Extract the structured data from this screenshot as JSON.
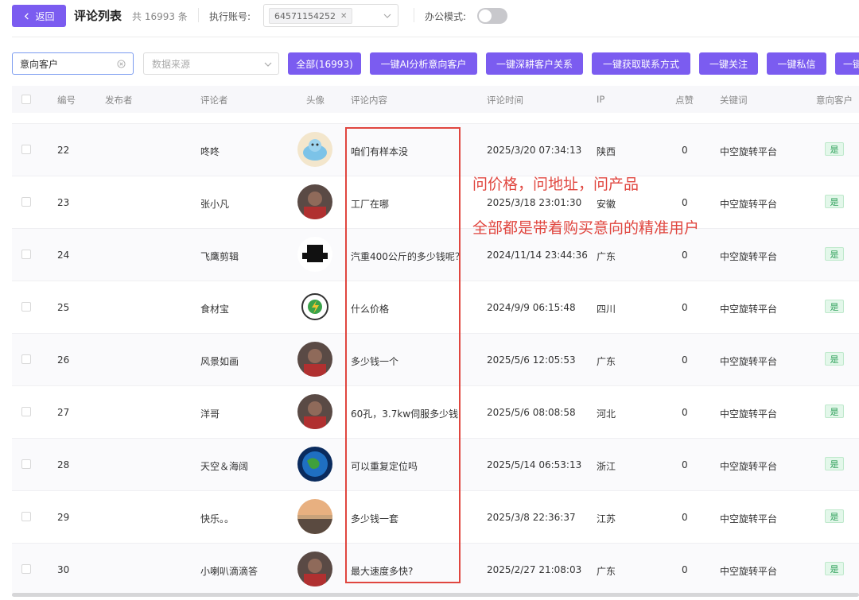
{
  "header": {
    "back_label": "返回",
    "title": "评论列表",
    "total": "共 16993 条",
    "account_label": "执行账号:",
    "account_value": "64571154252",
    "office_mode_label": "办公模式:"
  },
  "toolbar": {
    "filter_value": "意向客户",
    "source_placeholder": "数据来源",
    "buttons": [
      "全部(16993)",
      "一键AI分析意向客户",
      "一键深耕客户关系",
      "一键获取联系方式",
      "一键关注",
      "一键私信",
      "一键"
    ]
  },
  "table": {
    "columns": [
      "编号",
      "发布者",
      "评论者",
      "头像",
      "评论内容",
      "评论时间",
      "IP",
      "点赞",
      "关键词",
      "意向客户"
    ],
    "rows": [
      {
        "id": "22",
        "publisher": "",
        "commenter": "咚咚",
        "avatar": "cartoon-avatar",
        "content": "咱们有样本没",
        "time": "2025/3/20 07:34:13",
        "ip": "陕西",
        "likes": "0",
        "keyword": "中空旋转平台",
        "intent": "是"
      },
      {
        "id": "23",
        "publisher": "",
        "commenter": "张小凡",
        "avatar": "photo-avatar",
        "content": "工厂在哪",
        "time": "2025/3/18 23:01:30",
        "ip": "安徽",
        "likes": "0",
        "keyword": "中空旋转平台",
        "intent": "是"
      },
      {
        "id": "24",
        "publisher": "",
        "commenter": "飞鹰剪辑",
        "avatar": "logo-avatar",
        "content": "汽重400公斤的多少钱呢？...",
        "time": "2024/11/14 23:44:36",
        "ip": "广东",
        "likes": "0",
        "keyword": "中空旋转平台",
        "intent": "是"
      },
      {
        "id": "25",
        "publisher": "",
        "commenter": "食材宝",
        "avatar": "badge-avatar",
        "content": "什么价格",
        "time": "2024/9/9 06:15:48",
        "ip": "四川",
        "likes": "0",
        "keyword": "中空旋转平台",
        "intent": "是"
      },
      {
        "id": "26",
        "publisher": "",
        "commenter": "风景如画",
        "avatar": "photo-avatar",
        "content": "多少钱一个",
        "time": "2025/5/6 12:05:53",
        "ip": "广东",
        "likes": "0",
        "keyword": "中空旋转平台",
        "intent": "是"
      },
      {
        "id": "27",
        "publisher": "",
        "commenter": "洋哥",
        "avatar": "photo-avatar",
        "content": "60孔，3.7kw伺服多少钱",
        "time": "2025/5/6 08:08:58",
        "ip": "河北",
        "likes": "0",
        "keyword": "中空旋转平台",
        "intent": "是"
      },
      {
        "id": "28",
        "publisher": "",
        "commenter": "天空＆海阔",
        "avatar": "earth-avatar",
        "content": "可以重复定位吗",
        "time": "2025/5/14 06:53:13",
        "ip": "浙江",
        "likes": "0",
        "keyword": "中空旋转平台",
        "intent": "是"
      },
      {
        "id": "29",
        "publisher": "",
        "commenter": "快乐。。",
        "avatar": "sunset-avatar",
        "content": "多少钱一套",
        "time": "2025/3/8 22:36:37",
        "ip": "江苏",
        "likes": "0",
        "keyword": "中空旋转平台",
        "intent": "是"
      },
      {
        "id": "30",
        "publisher": "",
        "commenter": "小喇叭滴滴答",
        "avatar": "photo-avatar",
        "content": "最大速度多快?",
        "time": "2025/2/27 21:08:03",
        "ip": "广东",
        "likes": "0",
        "keyword": "中空旋转平台",
        "intent": "是"
      }
    ]
  },
  "annotations": {
    "note1": "问价格，问地址，问产品",
    "note2": "全部都是带着购买意向的精准用户"
  },
  "colors": {
    "accent": "#7b5cf0",
    "highlight": "#e0463f",
    "badge_green": "#2ea05a"
  }
}
